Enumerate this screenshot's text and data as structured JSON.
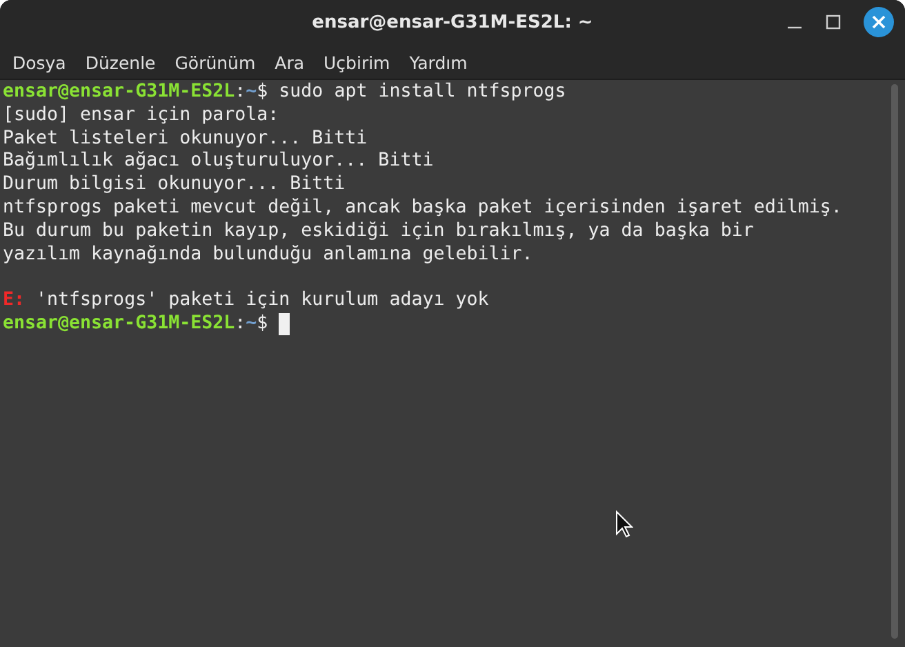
{
  "window": {
    "title": "ensar@ensar-G31M-ES2L: ~"
  },
  "menu": [
    "Dosya",
    "Düzenle",
    "Görünüm",
    "Ara",
    "Uçbirim",
    "Yardım"
  ],
  "terminal": {
    "lines": [
      {
        "kind": "text",
        "segments": [
          {
            "kind": "user",
            "text": "ensar@ensar-G31M-ES2L"
          },
          {
            "kind": "plain",
            "text": ":"
          },
          {
            "kind": "path",
            "text": "~"
          },
          {
            "kind": "plain",
            "text": "$ sudo apt install ntfsprogs"
          }
        ]
      },
      {
        "kind": "text",
        "segments": [
          {
            "kind": "plain",
            "text": "[sudo] ensar için parola:"
          }
        ]
      },
      {
        "kind": "text",
        "segments": [
          {
            "kind": "plain",
            "text": "Paket listeleri okunuyor... Bitti"
          }
        ]
      },
      {
        "kind": "text",
        "segments": [
          {
            "kind": "plain",
            "text": "Bağımlılık ağacı oluşturuluyor... Bitti"
          }
        ]
      },
      {
        "kind": "text",
        "segments": [
          {
            "kind": "plain",
            "text": "Durum bilgisi okunuyor... Bitti"
          }
        ]
      },
      {
        "kind": "text",
        "segments": [
          {
            "kind": "plain",
            "text": "ntfsprogs paketi mevcut değil, ancak başka paket içerisinden işaret edilmiş."
          }
        ]
      },
      {
        "kind": "text",
        "segments": [
          {
            "kind": "plain",
            "text": "Bu durum bu paketin kayıp, eskidiği için bırakılmış, ya da başka bir"
          }
        ]
      },
      {
        "kind": "text",
        "segments": [
          {
            "kind": "plain",
            "text": "yazılım kaynağında bulunduğu anlamına gelebilir."
          }
        ]
      },
      {
        "kind": "blank"
      },
      {
        "kind": "text",
        "segments": [
          {
            "kind": "error",
            "text": "E:"
          },
          {
            "kind": "plain",
            "text": " 'ntfsprogs' paketi için kurulum adayı yok"
          }
        ]
      },
      {
        "kind": "text",
        "cursor": true,
        "segments": [
          {
            "kind": "user",
            "text": "ensar@ensar-G31M-ES2L"
          },
          {
            "kind": "plain",
            "text": ":"
          },
          {
            "kind": "path",
            "text": "~"
          },
          {
            "kind": "plain",
            "text": "$ "
          }
        ]
      }
    ]
  }
}
